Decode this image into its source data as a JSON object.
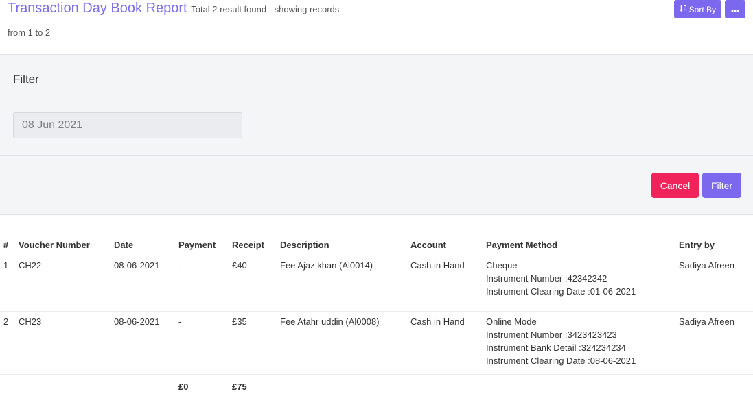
{
  "header": {
    "title": "Transaction Day Book Report",
    "result_line1": "Total 2 result found - showing records",
    "result_line2": "from 1 to 2",
    "sort_label": "Sort By",
    "sort_icon": "sort-icon",
    "more_icon": "ellipsis-icon"
  },
  "filter": {
    "title": "Filter",
    "date_value": "08 Jun 2021",
    "cancel_label": "Cancel",
    "filter_label": "Filter"
  },
  "table": {
    "columns": [
      "#",
      "Voucher Number",
      "Date",
      "Payment",
      "Receipt",
      "Description",
      "Account",
      "Payment Method",
      "Entry by"
    ],
    "rows": [
      {
        "num": "1",
        "voucher": "CH22",
        "date": "08-06-2021",
        "payment": "-",
        "receipt": "£40",
        "description": "Fee Ajaz khan (Al0014)",
        "account": "Cash in Hand",
        "method": [
          "Cheque",
          "Instrument Number :42342342",
          "Instrument Clearing Date :01-06-2021"
        ],
        "entry_by": "Sadiya Afreen"
      },
      {
        "num": "2",
        "voucher": "CH23",
        "date": "08-06-2021",
        "payment": "-",
        "receipt": "£35",
        "description": "Fee Atahr uddin (Al0008)",
        "account": "Cash in Hand",
        "method": [
          "Online Mode",
          "Instrument Number :3423423423",
          "Instrument Bank Detail :324234234",
          "Instrument Clearing Date :08-06-2021"
        ],
        "entry_by": "Sadiya Afreen"
      }
    ],
    "totals": {
      "payment": "£0",
      "receipt": "£75"
    }
  },
  "colors": {
    "accent": "#7b68ee",
    "danger": "#f0245a",
    "title": "#7b6cf0"
  }
}
